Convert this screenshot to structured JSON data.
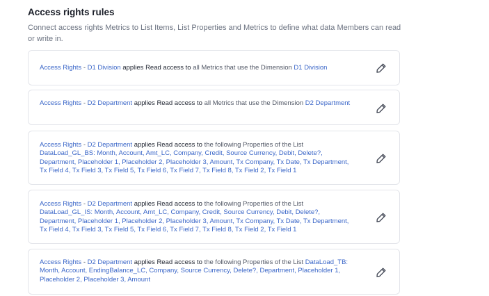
{
  "header": {
    "title": "Access rights rules",
    "subtitle": "Connect access rights Metrics to List Items, List Properties and Metrics to define what data Members can read or write in."
  },
  "rules": [
    {
      "segments": [
        {
          "t": "Access Rights",
          "c": "blue"
        },
        {
          "t": " - ",
          "c": "gray"
        },
        {
          "t": "D1 Division",
          "c": "blue"
        },
        {
          "t": " applies Read access to ",
          "c": "dark"
        },
        {
          "t": "all Metrics that use the Dimension ",
          "c": "gray"
        },
        {
          "t": "D1 Division",
          "c": "blue"
        }
      ]
    },
    {
      "segments": [
        {
          "t": "Access Rights",
          "c": "blue"
        },
        {
          "t": " - ",
          "c": "gray"
        },
        {
          "t": "D2 Department",
          "c": "blue"
        },
        {
          "t": " applies Read access to ",
          "c": "dark"
        },
        {
          "t": "all Metrics that use the Dimension ",
          "c": "gray"
        },
        {
          "t": "D2 Department",
          "c": "blue"
        }
      ]
    },
    {
      "segments": [
        {
          "t": "Access Rights",
          "c": "blue"
        },
        {
          "t": " - ",
          "c": "gray"
        },
        {
          "t": "D2 Department",
          "c": "blue"
        },
        {
          "t": " applies Read access to ",
          "c": "dark"
        },
        {
          "t": "the following Properties of the List ",
          "c": "gray"
        },
        {
          "t": "DataLoad_GL_BS: Month, Account, Amt_LC, Company, Credit, Source Currency, Debit, Delete?, Department, Placeholder 1, Placeholder 2, Placeholder 3, Amount, Tx Company, Tx Date, Tx Department, Tx Field 4, Tx Field 3, Tx Field 5, Tx Field 6, Tx Field 7, Tx Field 8, Tx Field 2, Tx Field 1",
          "c": "blue"
        }
      ]
    },
    {
      "segments": [
        {
          "t": "Access Rights",
          "c": "blue"
        },
        {
          "t": " - ",
          "c": "gray"
        },
        {
          "t": "D2 Department",
          "c": "blue"
        },
        {
          "t": " applies Read access to ",
          "c": "dark"
        },
        {
          "t": "the following Properties of the List ",
          "c": "gray"
        },
        {
          "t": "DataLoad_GL_IS: Month, Account, Amt_LC, Company, Credit, Source Currency, Debit, Delete?, Department, Placeholder 1, Placeholder 2, Placeholder 3, Amount, Tx Company, Tx Date, Tx Department, Tx Field 4, Tx Field 3, Tx Field 5, Tx Field 6, Tx Field 7, Tx Field 8, Tx Field 2, Tx Field 1",
          "c": "blue"
        }
      ]
    },
    {
      "segments": [
        {
          "t": "Access Rights",
          "c": "blue"
        },
        {
          "t": " - ",
          "c": "gray"
        },
        {
          "t": "D2 Department",
          "c": "blue"
        },
        {
          "t": " applies Read access to ",
          "c": "dark"
        },
        {
          "t": "the following Properties of the List ",
          "c": "gray"
        },
        {
          "t": "DataLoad_TB: Month, Account, EndingBalance_LC, Company, Source Currency, Delete?, Department, Placeholder 1, Placeholder 2, Placeholder 3, Amount",
          "c": "blue"
        }
      ]
    }
  ],
  "icons": {
    "edit": "pencil-icon"
  },
  "colors": {
    "link": "#3a66c8",
    "text": "#1f2430",
    "muted": "#525866",
    "border": "#e3e5ea"
  }
}
